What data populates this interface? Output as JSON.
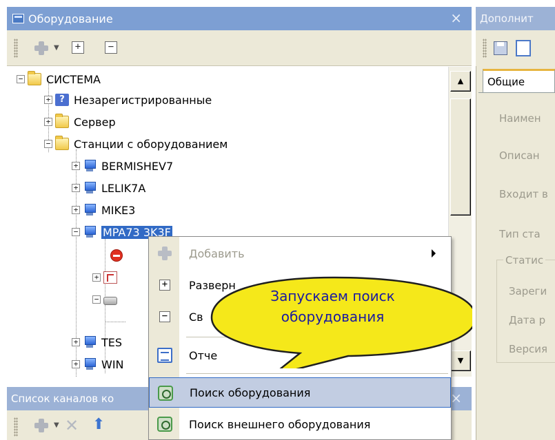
{
  "left_panel": {
    "title": "Оборудование",
    "close": "×",
    "toolbar": {
      "expand": "+",
      "collapse": "−"
    }
  },
  "tree": {
    "root": "СИСТЕМА",
    "items": [
      "Незарегистрированные",
      "Сервер",
      "Станции с оборудованием",
      "BERMISHEV7",
      "LELIK7A",
      "MIKE3",
      "MPA73 3K3F",
      "TES",
      "WIN"
    ]
  },
  "bottom_panel": {
    "title": "Список каналов ко",
    "close": "×"
  },
  "right_panel": {
    "title": "Дополнит",
    "tab": "Общие",
    "fields": [
      "Наимен",
      "Описан",
      "Входит в",
      "Тип ста"
    ],
    "group": "Статис",
    "group_fields": [
      "Зареги",
      "Дата р",
      "Версия"
    ]
  },
  "context_menu": {
    "items": [
      {
        "label": "Добавить",
        "disabled": true,
        "submenu": true
      },
      {
        "label": "Разверн",
        "disabled": false
      },
      {
        "label": "Св",
        "disabled": false
      },
      {
        "label": "Отче",
        "disabled": false
      },
      {
        "label": "Поиск оборудования",
        "disabled": false,
        "highlighted": true
      },
      {
        "label": "Поиск внешнего оборудования",
        "disabled": false
      }
    ]
  },
  "callout": {
    "line1": "Запускаем поиск",
    "line2": "оборудования"
  },
  "colors": {
    "selection": "#316ac5",
    "callout_fill": "#f5e81a",
    "callout_text": "#1a1aa0",
    "title_active": "#7d9fd3"
  }
}
